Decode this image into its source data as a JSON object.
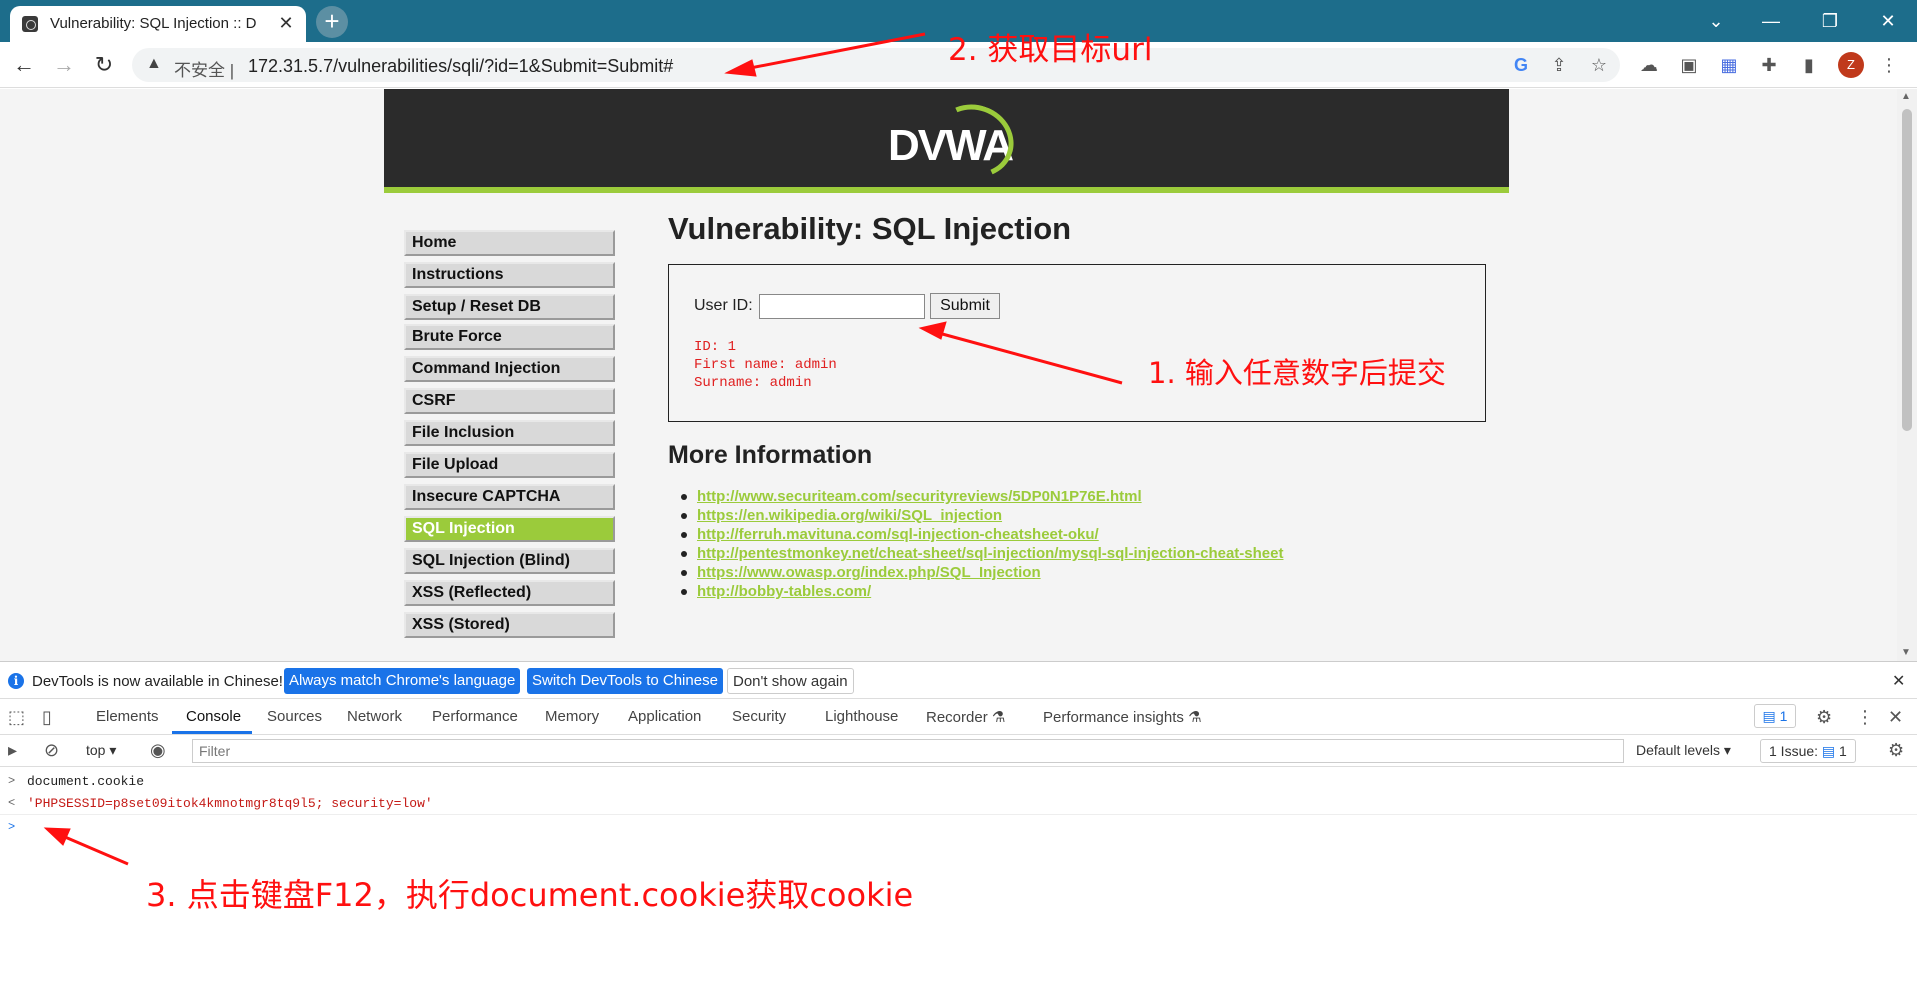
{
  "browser": {
    "tab_title": "Vulnerability: SQL Injection :: D",
    "new_tab": "+",
    "insecure_label": "不安全",
    "url": "172.31.5.7/vulnerabilities/sqli/?id=1&Submit=Submit#",
    "avatar_letter": "Z"
  },
  "dvwa": {
    "logo": "DVWA",
    "menu_group1": [
      "Home",
      "Instructions",
      "Setup / Reset DB"
    ],
    "menu_group2": [
      "Brute Force",
      "Command Injection",
      "CSRF",
      "File Inclusion",
      "File Upload",
      "Insecure CAPTCHA",
      "SQL Injection",
      "SQL Injection (Blind)",
      "XSS (Reflected)",
      "XSS (Stored)"
    ],
    "active_item": "SQL Injection",
    "page_title": "Vulnerability: SQL Injection",
    "form": {
      "user_id_label": "User ID:",
      "user_id_value": "",
      "submit_label": "Submit"
    },
    "output": [
      "ID: 1",
      "First name: admin",
      "Surname: admin"
    ],
    "more_info_title": "More Information",
    "links": [
      "http://www.securiteam.com/securityreviews/5DP0N1P76E.html",
      "https://en.wikipedia.org/wiki/SQL_injection",
      "http://ferruh.mavituna.com/sql-injection-cheatsheet-oku/",
      "http://pentestmonkey.net/cheat-sheet/sql-injection/mysql-sql-injection-cheat-sheet",
      "https://www.owasp.org/index.php/SQL_Injection",
      "http://bobby-tables.com/"
    ]
  },
  "devtools": {
    "info_message": "DevTools is now available in Chinese!",
    "btn_match": "Always match Chrome's language",
    "btn_switch": "Switch DevTools to Chinese",
    "btn_dont_show": "Don't show again",
    "tabs": [
      "Elements",
      "Console",
      "Sources",
      "Network",
      "Performance",
      "Memory",
      "Application",
      "Security",
      "Lighthouse",
      "Recorder",
      "Performance insights"
    ],
    "active_tab": "Console",
    "issues_badge": "1",
    "context": "top",
    "filter_placeholder": "Filter",
    "default_levels": "Default levels",
    "issues_label": "1 Issue:",
    "issues_count": "1",
    "console_input": "document.cookie",
    "console_result": "'PHPSESSID=p8set09itok4kmnotmgr8tq9l5; security=low'"
  },
  "annotations": {
    "note1": "1.  输入任意数字后提交",
    "note2": "2. 获取目标url",
    "note3": "3. 点击键盘F12，执行document.cookie获取cookie"
  },
  "colors": {
    "accent_green": "#9bcb3b",
    "annotation_red": "#ff1010",
    "chrome_titlebar": "#1d6d8b"
  }
}
